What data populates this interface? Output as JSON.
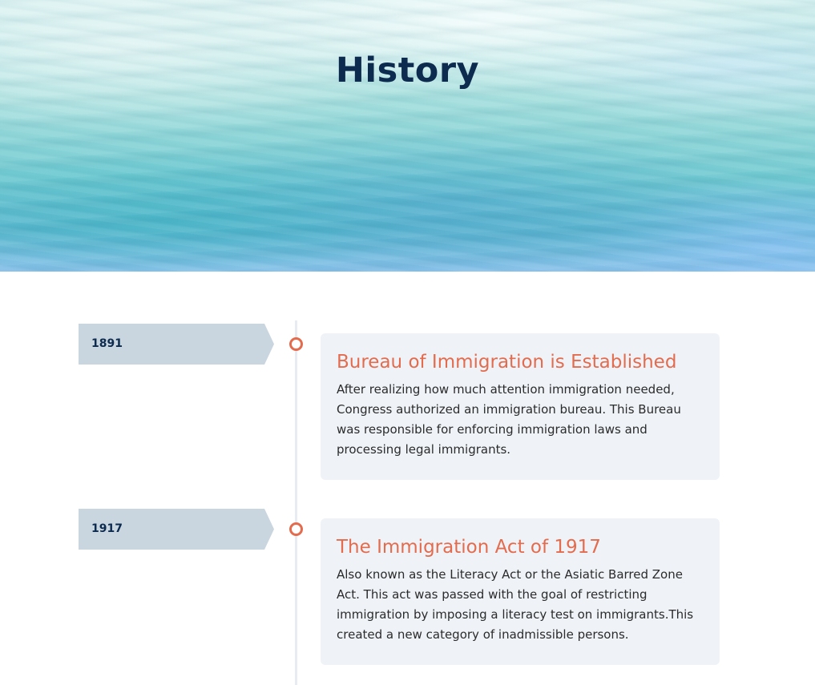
{
  "hero": {
    "title": "History"
  },
  "timeline": {
    "items": [
      {
        "year": "1891",
        "title": "Bureau of Immigration is Established",
        "body": "After realizing how much attention immigration needed, Congress authorized an immigration bureau. This Bureau was responsible for enforcing immigration laws and processing legal immigrants."
      },
      {
        "year": "1917",
        "title": "The Immigration Act of 1917",
        "body": "Also known as the Literacy Act or the Asiatic Barred Zone Act. This act was passed with the goal of restricting immigration by imposing a literacy test on immigrants.This created a new category of inadmissible persons."
      }
    ]
  },
  "colors": {
    "title_navy": "#0d2b4e",
    "accent_orange": "#e36b4e",
    "year_tab_gray": "#c9d5df",
    "card_background": "#eff3f7"
  }
}
